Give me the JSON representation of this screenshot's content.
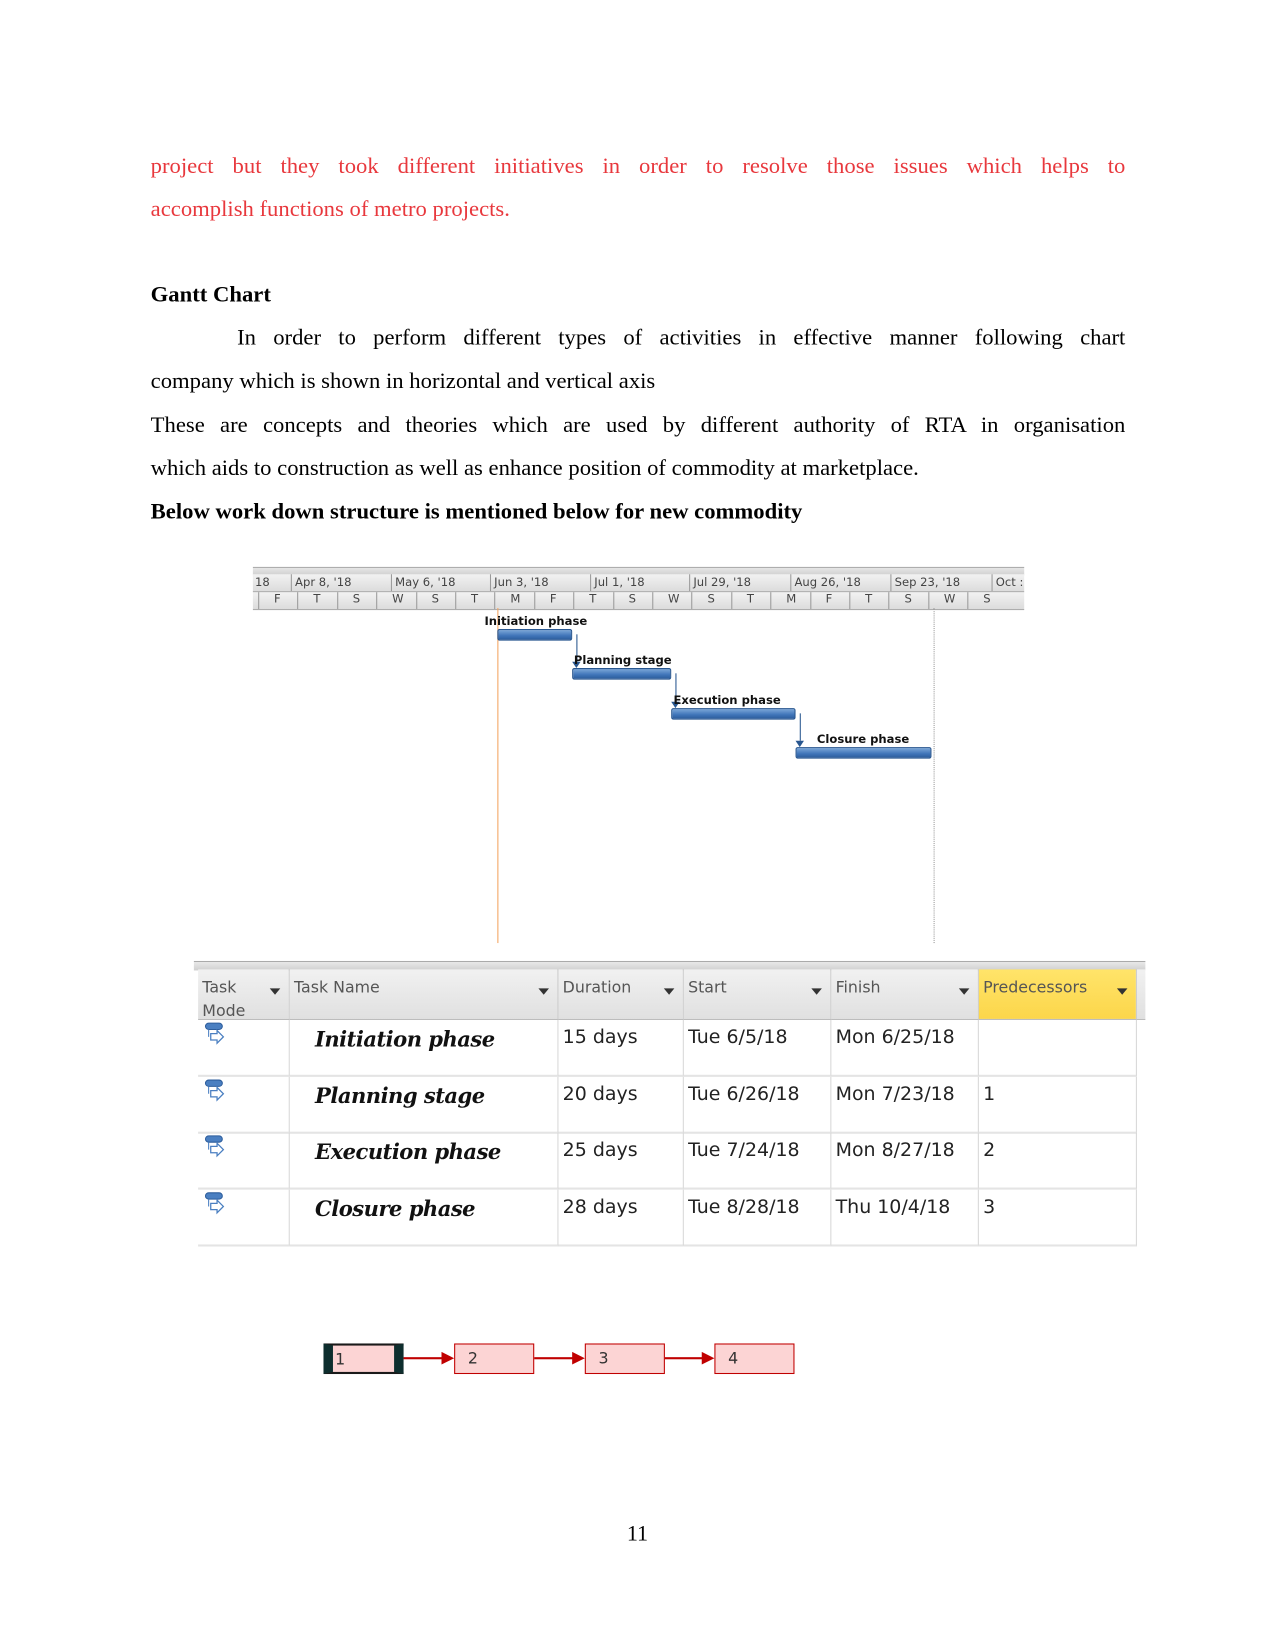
{
  "paragraphs": {
    "red_line1": "project but they took different initiatives in order to resolve those issues  which helps to",
    "red_line2": "accomplish functions of metro projects.",
    "heading": "Gantt Chart",
    "p1_line1": "In order to perform different types of activities in effective manner following chart",
    "p1_line2": "company which is shown in horizontal and vertical axis",
    "p2_line1": "These are concepts and theories which are used by different authority of RTA in organisation",
    "p2_line2": "which aids to construction as well as enhance position of commodity at marketplace.",
    "bold_line": "Below work down structure is mentioned below for new commodity"
  },
  "gantt": {
    "timescale_top": [
      "18",
      "Apr 8, '18",
      "May 6, '18",
      "Jun 3, '18",
      "Jul 1, '18",
      "Jul 29, '18",
      "Aug 26, '18",
      "Sep 23, '18",
      "Oct :"
    ],
    "timescale_bottom": [
      "F",
      "T",
      "S",
      "W",
      "S",
      "T",
      "M",
      "F",
      "T",
      "S",
      "W",
      "S",
      "T",
      "M",
      "F",
      "T",
      "S",
      "W",
      "S"
    ],
    "bar_color": "#4a7fc1",
    "current_date_line_color": "#f4a460",
    "tasks": [
      {
        "name": "Initiation phase",
        "start": "2018-06-05",
        "finish": "2018-06-25"
      },
      {
        "name": "Planning stage",
        "start": "2018-06-26",
        "finish": "2018-07-23"
      },
      {
        "name": "Execution phase",
        "start": "2018-07-24",
        "finish": "2018-08-27"
      },
      {
        "name": "Closure phase",
        "start": "2018-08-28",
        "finish": "2018-10-04"
      }
    ]
  },
  "table": {
    "headers": {
      "mode": "Task Mode",
      "name": "Task Name",
      "duration": "Duration",
      "start": "Start",
      "finish": "Finish",
      "predecessors": "Predecessors"
    },
    "highlight_color": "#fcd64a",
    "rows": [
      {
        "mode_icon": "auto-scheduled-task-icon",
        "name": "Initiation phase",
        "duration": "15 days",
        "start": "Tue 6/5/18",
        "finish": "Mon 6/25/18",
        "predecessors": ""
      },
      {
        "mode_icon": "auto-scheduled-task-icon",
        "name": "Planning stage",
        "duration": "20 days",
        "start": "Tue 6/26/18",
        "finish": "Mon 7/23/18",
        "predecessors": "1"
      },
      {
        "mode_icon": "auto-scheduled-task-icon",
        "name": "Execution phase",
        "duration": "25 days",
        "start": "Tue 7/24/18",
        "finish": "Mon 8/27/18",
        "predecessors": "2"
      },
      {
        "mode_icon": "auto-scheduled-task-icon",
        "name": "Closure phase",
        "duration": "28 days",
        "start": "Tue 8/28/18",
        "finish": "Thu 10/4/18",
        "predecessors": "3"
      }
    ]
  },
  "network": {
    "nodes": [
      "1",
      "2",
      "3",
      "4"
    ],
    "color": "#c00000"
  },
  "page_number": "11"
}
